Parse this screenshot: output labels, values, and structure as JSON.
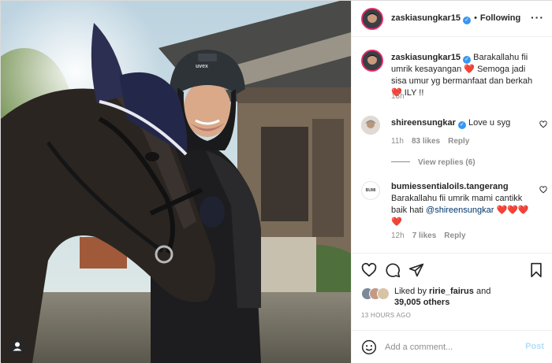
{
  "header": {
    "username": "zaskiasungkar15",
    "verified_mark": "✓",
    "separator": "•",
    "follow_status": "Following",
    "more_icon": "more-horizontal-icon",
    "more_glyph": "···"
  },
  "comments": [
    {
      "username": "zaskiasungkar15",
      "verified": true,
      "text": "Barakallahu fii umrik kesayangan ❤️ Semoga jadi sisa umur yg bermanfaat dan berkah❤️ ILY !!",
      "time": "13h"
    },
    {
      "username": "shireensungkar",
      "verified": true,
      "text": "Love u syg",
      "time": "11h",
      "likes": "83 likes",
      "reply_label": "Reply",
      "view_replies": "View replies (6)"
    },
    {
      "username": "bumiessentialoils.tangerang",
      "verified": false,
      "text_before": "Barakallahu fii umrik mami cantikk baik hati ",
      "mention": "@shireensungkar",
      "text_after": " ❤️❤️❤️❤️",
      "avatar_text": "BUMI",
      "time": "12h",
      "likes": "7 likes",
      "reply_label": "Reply"
    }
  ],
  "actions": {
    "like_icon": "heart-icon",
    "comment_icon": "comment-icon",
    "share_icon": "send-icon",
    "save_icon": "bookmark-icon"
  },
  "likes": {
    "prefix": "Liked by ",
    "user": "ririe_fairus",
    "middle": " and",
    "count": "39,005 others"
  },
  "timestamp": "13 HOURS AGO",
  "add_comment": {
    "placeholder": "Add a comment...",
    "post_label": "Post",
    "emoji_icon": "emoji-icon"
  },
  "photo": {
    "tagged_user_icon": "user-tag-icon",
    "helmet_brand": "uvex"
  },
  "colors": {
    "verified": "#3897f0",
    "link": "#00376b",
    "muted": "#8e8e8e",
    "post_button": "#b2dffc",
    "story_ring": "#e1306c"
  }
}
